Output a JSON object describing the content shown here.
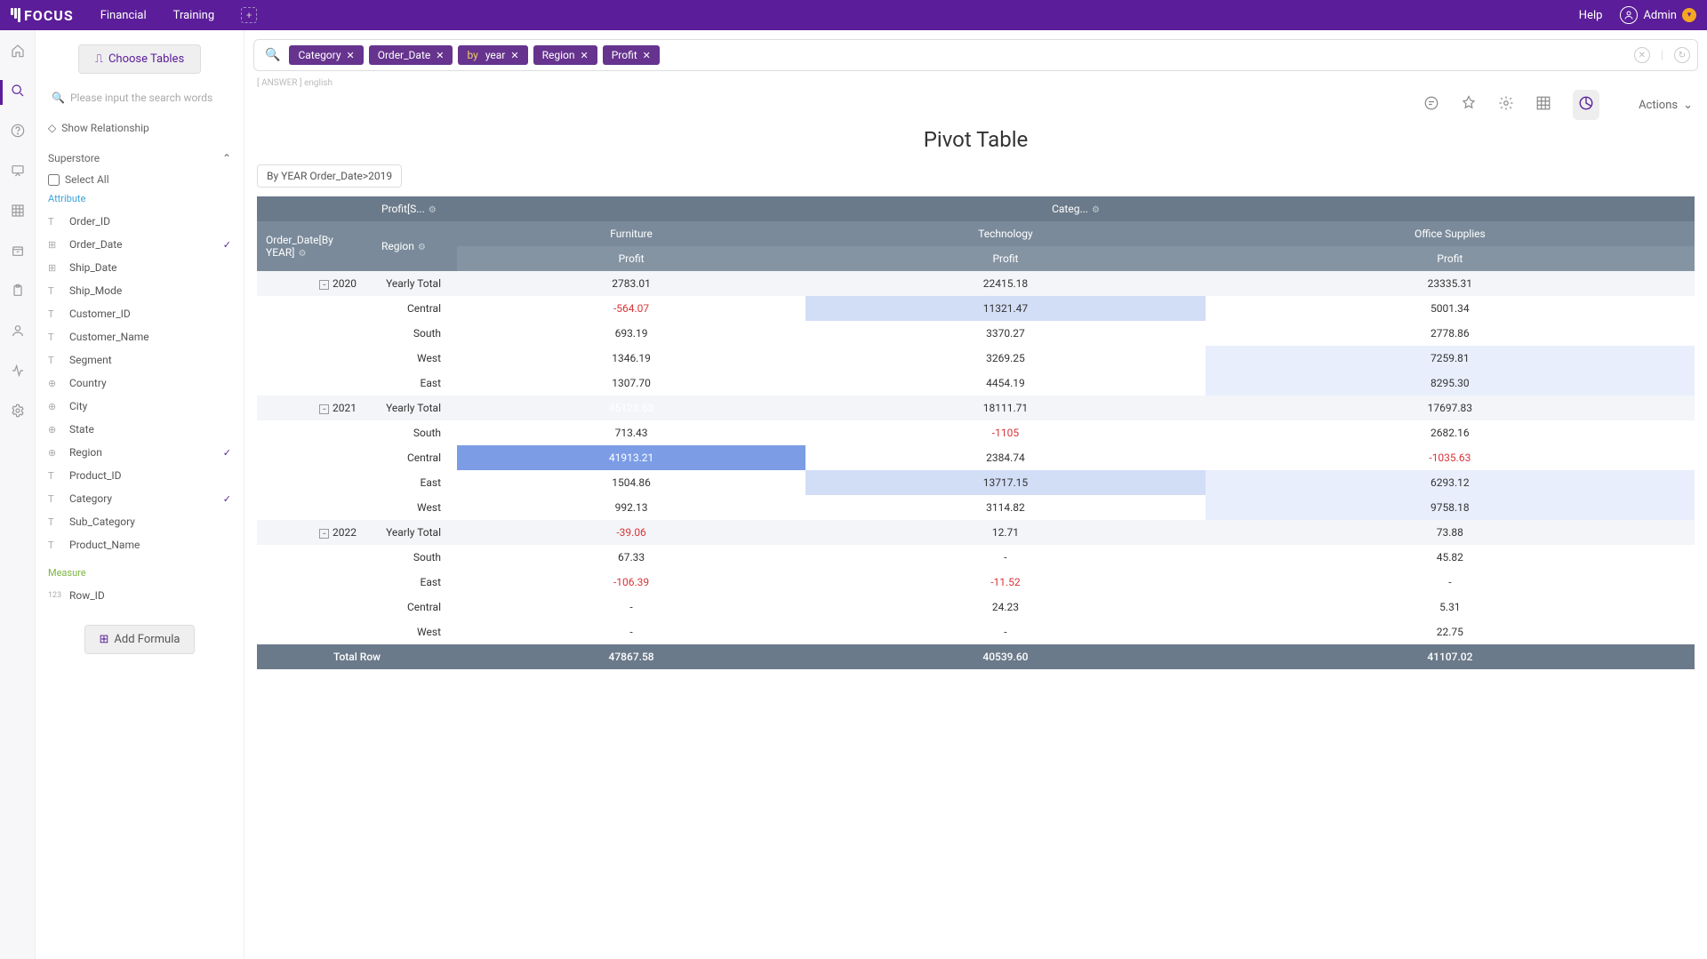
{
  "topbar": {
    "logo": "FOCUS",
    "tabs": [
      "Financial",
      "Training"
    ],
    "help": "Help",
    "user": "Admin"
  },
  "sidebar": {
    "choose_tables": "Choose Tables",
    "search_placeholder": "Please input the search words",
    "show_relationship": "Show Relationship",
    "datasource": "Superstore",
    "select_all": "Select All",
    "attribute_label": "Attribute",
    "measure_label": "Measure",
    "attributes": [
      {
        "icon": "T",
        "name": "Order_ID",
        "checked": false
      },
      {
        "icon": "⊞",
        "name": "Order_Date",
        "checked": true
      },
      {
        "icon": "⊞",
        "name": "Ship_Date",
        "checked": false
      },
      {
        "icon": "T",
        "name": "Ship_Mode",
        "checked": false
      },
      {
        "icon": "T",
        "name": "Customer_ID",
        "checked": false
      },
      {
        "icon": "T",
        "name": "Customer_Name",
        "checked": false
      },
      {
        "icon": "T",
        "name": "Segment",
        "checked": false
      },
      {
        "icon": "⊕",
        "name": "Country",
        "checked": false
      },
      {
        "icon": "⊕",
        "name": "City",
        "checked": false
      },
      {
        "icon": "⊕",
        "name": "State",
        "checked": false
      },
      {
        "icon": "⊕",
        "name": "Region",
        "checked": true
      },
      {
        "icon": "T",
        "name": "Product_ID",
        "checked": false
      },
      {
        "icon": "T",
        "name": "Category",
        "checked": true
      },
      {
        "icon": "T",
        "name": "Sub_Category",
        "checked": false
      },
      {
        "icon": "T",
        "name": "Product_Name",
        "checked": false
      }
    ],
    "measures": [
      {
        "icon": "123",
        "name": "Row_ID"
      }
    ],
    "add_formula": "Add Formula"
  },
  "query": {
    "pills": [
      {
        "text": "Category"
      },
      {
        "text": "Order_Date"
      },
      {
        "by": "by",
        "text": "year"
      },
      {
        "text": "Region"
      },
      {
        "text": "Profit"
      }
    ]
  },
  "breadcrumb": {
    "answer": "ANSWER",
    "lang": "english"
  },
  "actions_label": "Actions",
  "title": "Pivot Table",
  "filter_chip": "By YEAR Order_Date>2019",
  "table": {
    "h_profit": "Profit[S...",
    "h_categ": "Categ...",
    "h_order_date": "Order_Date[By YEAR]",
    "h_region": "Region",
    "cats": [
      "Furniture",
      "Technology",
      "Office Supplies"
    ],
    "metric": "Profit",
    "total_row_label": "Total Row",
    "yearly_total": "Yearly Total",
    "years": [
      {
        "year": "2020",
        "total": [
          "2783.01",
          "22415.18",
          "23335.31"
        ],
        "total_hl": [
          "hl1",
          "hl2",
          "hl2"
        ],
        "rows": [
          {
            "region": "Central",
            "v": [
              "-564.07",
              "11321.47",
              "5001.34"
            ],
            "hl": [
              "",
              "hl2",
              ""
            ],
            "neg": [
              true,
              false,
              false
            ]
          },
          {
            "region": "South",
            "v": [
              "693.19",
              "3370.27",
              "2778.86"
            ],
            "hl": [
              "",
              "",
              ""
            ],
            "neg": [
              false,
              false,
              false
            ]
          },
          {
            "region": "West",
            "v": [
              "1346.19",
              "3269.25",
              "7259.81"
            ],
            "hl": [
              "",
              "",
              "hl1"
            ],
            "neg": [
              false,
              false,
              false
            ]
          },
          {
            "region": "East",
            "v": [
              "1307.70",
              "4454.19",
              "8295.30"
            ],
            "hl": [
              "",
              "",
              "hl1"
            ],
            "neg": [
              false,
              false,
              false
            ]
          }
        ]
      },
      {
        "year": "2021",
        "total": [
          "45123.63",
          "18111.71",
          "17697.83"
        ],
        "total_hl": [
          "hl5",
          "hl2",
          "hl2"
        ],
        "rows": [
          {
            "region": "South",
            "v": [
              "713.43",
              "-1105",
              "2682.16"
            ],
            "hl": [
              "",
              "",
              ""
            ],
            "neg": [
              false,
              true,
              false
            ]
          },
          {
            "region": "Central",
            "v": [
              "41913.21",
              "2384.74",
              "-1035.63"
            ],
            "hl": [
              "hl4",
              "",
              ""
            ],
            "neg": [
              false,
              false,
              true
            ]
          },
          {
            "region": "East",
            "v": [
              "1504.86",
              "13717.15",
              "6293.12"
            ],
            "hl": [
              "",
              "hl2",
              "hl1"
            ],
            "neg": [
              false,
              false,
              false
            ]
          },
          {
            "region": "West",
            "v": [
              "992.13",
              "3114.82",
              "9758.18"
            ],
            "hl": [
              "",
              "",
              "hl1"
            ],
            "neg": [
              false,
              false,
              false
            ]
          }
        ]
      },
      {
        "year": "2022",
        "total": [
          "-39.06",
          "12.71",
          "73.88"
        ],
        "total_hl": [
          "",
          "",
          ""
        ],
        "total_neg": [
          true,
          false,
          false
        ],
        "rows": [
          {
            "region": "South",
            "v": [
              "67.33",
              "-",
              "45.82"
            ],
            "hl": [
              "",
              "",
              ""
            ],
            "neg": [
              false,
              false,
              false
            ]
          },
          {
            "region": "East",
            "v": [
              "-106.39",
              "-11.52",
              "-"
            ],
            "hl": [
              "",
              "",
              ""
            ],
            "neg": [
              true,
              true,
              false
            ]
          },
          {
            "region": "Central",
            "v": [
              "-",
              "24.23",
              "5.31"
            ],
            "hl": [
              "",
              "",
              ""
            ],
            "neg": [
              false,
              false,
              false
            ]
          },
          {
            "region": "West",
            "v": [
              "-",
              "-",
              "22.75"
            ],
            "hl": [
              "",
              "",
              ""
            ],
            "neg": [
              false,
              false,
              false
            ]
          }
        ]
      }
    ],
    "grand_total": [
      "47867.58",
      "40539.60",
      "41107.02"
    ]
  }
}
